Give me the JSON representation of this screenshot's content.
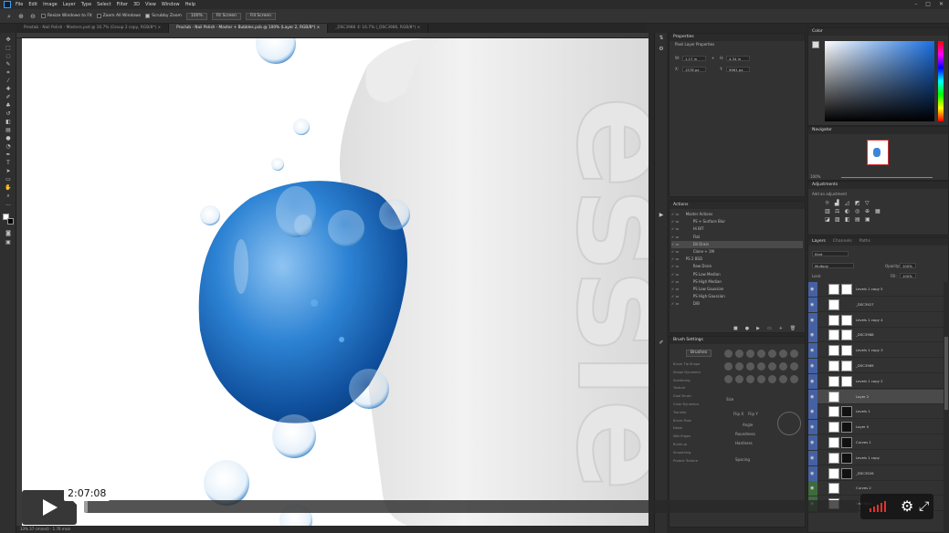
{
  "menu": [
    "File",
    "Edit",
    "Image",
    "Layer",
    "Type",
    "Select",
    "Filter",
    "3D",
    "View",
    "Window",
    "Help"
  ],
  "window_controls": [
    "–",
    "□",
    "✕"
  ],
  "options": {
    "resize_windows": "Resize Windows to Fit",
    "zoom_all": "Zoom All Windows",
    "scrubby_zoom": "Scrubby Zoom",
    "zoom_level": "100%",
    "fit_screen": "Fit Screen",
    "fill_screen": "Fill Screen"
  },
  "tabs": [
    "Prostab - Nail Polish - Masters.psd @ 16.7% (Group 2 copy, RGB/8*) ×",
    "Proclub - Nail Polish - Master + Bubbles.psb @ 100% (Layer 2, RGB/8*) ×",
    "_DSC3986 © 16.7% (_DSC3986, RGB/8*) ×"
  ],
  "status": "33%   37 cm(est) · 1.76 ms/s",
  "properties": {
    "title": "Properties",
    "subtitle": "Pixel Layer Properties",
    "w": "1.17 in",
    "h": "4.34 in",
    "x": "1578 px",
    "y": "9961 px",
    "w_label": "W:",
    "h_label": "H:",
    "x_label": "X:",
    "y_label": "Y:"
  },
  "color": {
    "title": "Color",
    "accent": "#1a6fe0"
  },
  "navigator": {
    "title": "Navigator",
    "zoom": "100%"
  },
  "adjustments": {
    "title": "Adjustments",
    "hint": "Add an adjustment"
  },
  "actions": {
    "title": "Actions",
    "items": [
      "Master Actions",
      "PS + Surface Blur",
      "Hi BIT",
      "Flat",
      "Dil Drain",
      "Clone + 1M",
      "PS 2 BSD",
      "Raw Drain",
      "PS Low Median",
      "PS High Median",
      "PS Low Gaussian",
      "PS High Gaussian",
      "D/B"
    ]
  },
  "brush": {
    "title": "Brush Settings",
    "tab": "Brushes",
    "items": [
      "Brush Tip Shape",
      "Shape Dynamics",
      "Scattering",
      "Texture",
      "Dual Brush",
      "Color Dynamics",
      "Transfer",
      "Brush Pose",
      "Noise",
      "Wet Edges",
      "Build-up",
      "Smoothing",
      "Protect Texture"
    ],
    "labels": {
      "size": "Size",
      "angle": "Angle",
      "roundness": "Roundness",
      "hardness": "Hardness",
      "spacing": "Spacing",
      "flip_x": "Flip X",
      "flip_y": "Flip Y"
    }
  },
  "layers": {
    "tabs": [
      "Layers",
      "Channels",
      "Paths"
    ],
    "kind": "Kind",
    "blend": "Multiply",
    "opacity_label": "Opacity:",
    "opacity": "100%",
    "fill_label": "Fill:",
    "fill": "100%",
    "lock_label": "Lock:",
    "items": [
      {
        "name": "Levels 1 copy 5",
        "mask": "light"
      },
      {
        "name": "_DSC3927",
        "mask": "none"
      },
      {
        "name": "Levels 1 copy 4",
        "mask": "light"
      },
      {
        "name": "_DSC3988",
        "mask": "light"
      },
      {
        "name": "Levels 1 copy 3",
        "mask": "light"
      },
      {
        "name": "_DSC3989",
        "mask": "light"
      },
      {
        "name": "Levels 1 copy 2",
        "mask": "light"
      },
      {
        "name": "Layer 2",
        "mask": "none"
      },
      {
        "name": "Levels 1",
        "mask": "dark"
      },
      {
        "name": "Layer 0",
        "mask": "dark"
      },
      {
        "name": "Curves 1",
        "mask": "dark"
      },
      {
        "name": "Levels 1 copy",
        "mask": "dark"
      },
      {
        "name": "_DSC3926",
        "mask": "dark"
      },
      {
        "name": "Curves 2",
        "mask": "none"
      },
      {
        "name": "Sad Rock",
        "mask": "none"
      }
    ]
  },
  "canvas": {
    "brand_text": "essie",
    "bg": "#ffffff",
    "bubble_color": "#1e6fc4"
  },
  "video": {
    "time": "2:07:08",
    "progress_fraction": 0.005,
    "icons": [
      "play-icon",
      "volume-icon",
      "settings-icon",
      "fullscreen-icon"
    ]
  }
}
